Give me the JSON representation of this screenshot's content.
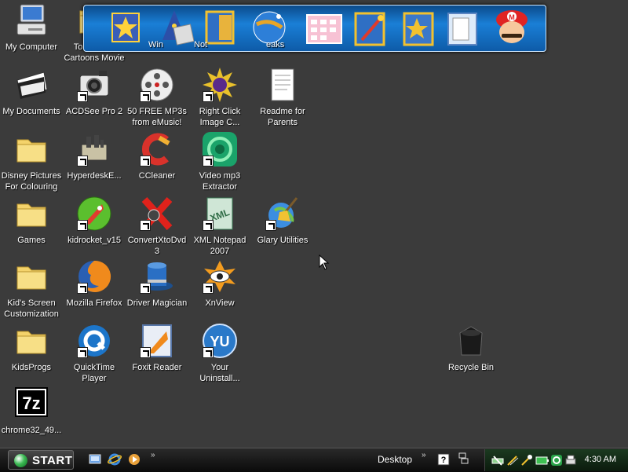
{
  "desktop_icons": [
    {
      "label": "My Computer",
      "shortcut": false,
      "icon": "my-computer-icon"
    },
    {
      "label": "Tom&Jerry\nCartoons Movie",
      "shortcut": false,
      "icon": "folder-icon"
    },
    {
      "label": "My Documents",
      "shortcut": false,
      "icon": "my-documents-icon"
    },
    {
      "label": "ACDSee Pro 2",
      "shortcut": true,
      "icon": "camera-icon"
    },
    {
      "label": "50 FREE MP3s\nfrom eMusic!",
      "shortcut": true,
      "icon": "film-reel-icon"
    },
    {
      "label": "Right Click\nImage C...",
      "shortcut": true,
      "icon": "sunburst-icon"
    },
    {
      "label": "Readme for\nParents",
      "shortcut": false,
      "icon": "text-document-icon"
    },
    {
      "label": "Disney Pictures\nFor Colouring",
      "shortcut": false,
      "icon": "folder-icon"
    },
    {
      "label": "HyperdeskE...",
      "shortcut": true,
      "icon": "hyperdesk-icon"
    },
    {
      "label": "CCleaner",
      "shortcut": true,
      "icon": "ccleaner-icon"
    },
    {
      "label": "Video mp3\nExtractor",
      "shortcut": true,
      "icon": "swirl-icon"
    },
    {
      "label": "Games",
      "shortcut": false,
      "icon": "folder-icon"
    },
    {
      "label": "kidrocket_v15",
      "shortcut": true,
      "icon": "rocket-icon"
    },
    {
      "label": "ConvertXtoDvd\n3",
      "shortcut": true,
      "icon": "convertx-icon"
    },
    {
      "label": "XML Notepad\n2007",
      "shortcut": true,
      "icon": "xml-icon"
    },
    {
      "label": "Glary Utilities",
      "shortcut": true,
      "icon": "broom-globe-icon"
    },
    {
      "label": "Kid's Screen\nCustomization",
      "shortcut": false,
      "icon": "folder-icon"
    },
    {
      "label": "Mozilla Firefox",
      "shortcut": true,
      "icon": "firefox-icon"
    },
    {
      "label": "Driver Magician",
      "shortcut": true,
      "icon": "magic-hat-icon"
    },
    {
      "label": "XnView",
      "shortcut": true,
      "icon": "xnview-icon"
    },
    {
      "label": "KidsProgs",
      "shortcut": false,
      "icon": "folder-icon"
    },
    {
      "label": "QuickTime\nPlayer",
      "shortcut": true,
      "icon": "quicktime-icon"
    },
    {
      "label": "Foxit Reader",
      "shortcut": true,
      "icon": "foxit-icon"
    },
    {
      "label": "Your\nUninstall...",
      "shortcut": true,
      "icon": "uninstaller-icon"
    },
    {
      "label": "Recycle Bin",
      "shortcut": false,
      "icon": "recycle-bin-icon"
    },
    {
      "label": "chrome32_49...",
      "shortcut": false,
      "icon": "7zip-icon"
    }
  ],
  "dock": {
    "items": [
      {
        "icon": "star-wand-icon"
      },
      {
        "icon": "wizard-hat-icon"
      },
      {
        "icon": "stamp-icon"
      },
      {
        "icon": "blue-folder-icon"
      },
      {
        "icon": "globe-wand-icon"
      },
      {
        "icon": "calendar-icon"
      },
      {
        "icon": "folder-wand-icon"
      },
      {
        "icon": "folder-star-icon"
      },
      {
        "icon": "folder-doc-icon"
      },
      {
        "icon": "mario-icon"
      }
    ],
    "visible_labels": [
      "Win",
      "Not",
      "eaks"
    ]
  },
  "taskbar": {
    "start_label": "START",
    "quicklaunch": [
      {
        "icon": "show-desktop-icon"
      },
      {
        "icon": "internet-explorer-icon"
      },
      {
        "icon": "media-player-icon"
      }
    ],
    "overflow_chevron": "»",
    "toolbar_label": "Desktop",
    "toolbar_chevron": "»",
    "tray_icons": [
      {
        "icon": "help-icon"
      },
      {
        "icon": "restore-icon"
      },
      {
        "icon": "network-icon"
      },
      {
        "icon": "wand-icon"
      },
      {
        "icon": "sparkle-icon"
      },
      {
        "icon": "battery-icon"
      },
      {
        "icon": "refresh-icon"
      },
      {
        "icon": "printer-icon"
      }
    ],
    "clock": "4:30 AM"
  },
  "colors": {
    "desktop_bg": "#3b3b3b",
    "taskbar_bg": "#111111",
    "tray_bg": "#123018",
    "dock_blue": "#1a7fd6",
    "label_text": "#ffffff"
  }
}
